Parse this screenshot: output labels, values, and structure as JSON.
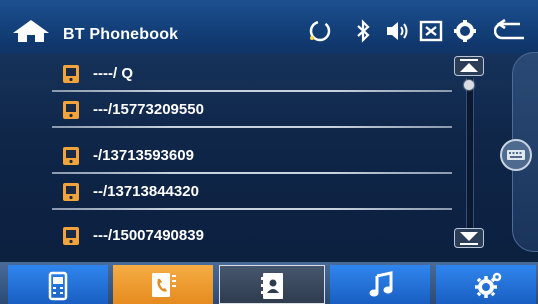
{
  "header": {
    "title": "BT Phonebook",
    "icons": [
      "home-icon",
      "sync-icon",
      "bluetooth-icon",
      "volume-icon",
      "close-box-icon",
      "settings-icon",
      "back-icon"
    ]
  },
  "contacts": [
    {
      "label": "----/ Q"
    },
    {
      "label": "---/15773209550"
    },
    {
      "label": "-/13713593609"
    },
    {
      "label": "--/13713844320"
    },
    {
      "label": "---/15007490839"
    }
  ],
  "scroll": {
    "position": 0
  },
  "tabs": [
    {
      "name": "phone-tab",
      "icon": "mobile-phone-icon",
      "active": false
    },
    {
      "name": "call-log-tab",
      "icon": "call-log-icon",
      "active": false
    },
    {
      "name": "phonebook-tab",
      "icon": "contacts-book-icon",
      "active": true
    },
    {
      "name": "music-tab",
      "icon": "music-note-icon",
      "active": false
    },
    {
      "name": "settings-tab",
      "icon": "gear-icon",
      "active": false
    }
  ],
  "colors": {
    "accent": "#f2a33a",
    "tab_blue": "#1f74d8",
    "active_tab": "#39475c"
  }
}
